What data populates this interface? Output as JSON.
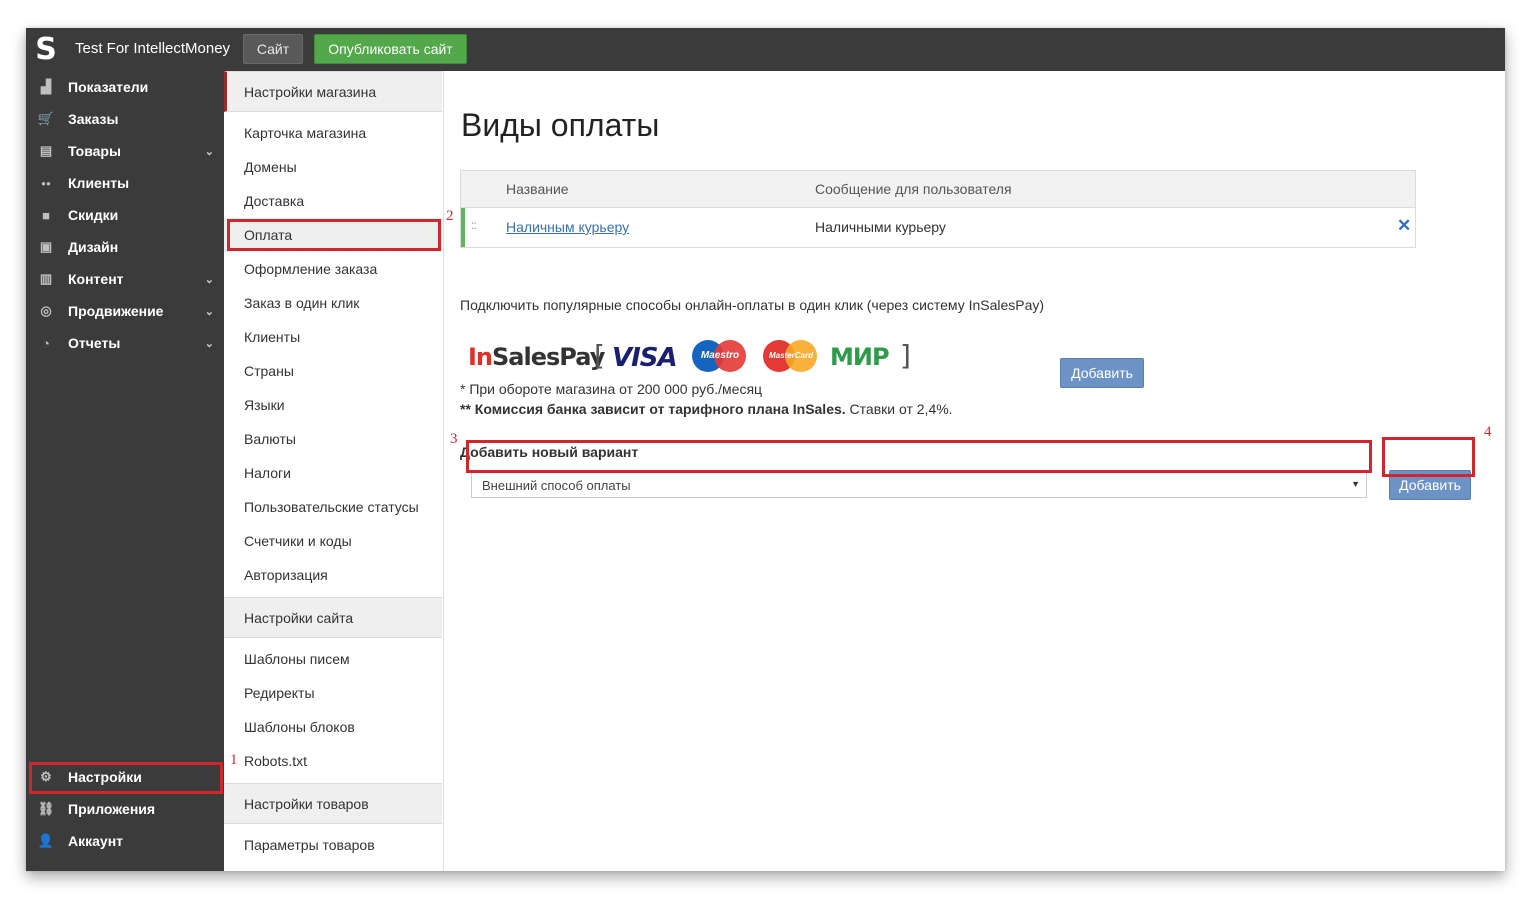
{
  "topbar": {
    "logo_glyph": "S",
    "shop_name": "Test For IntellectMoney",
    "site_button": "Сайт",
    "publish_button": "Опубликовать сайт"
  },
  "sidebar": {
    "items": [
      {
        "label": "Показатели",
        "icon": "chart-icon",
        "glyph": "▟"
      },
      {
        "label": "Заказы",
        "icon": "cart-icon",
        "glyph": "🛒"
      },
      {
        "label": "Товары",
        "icon": "book-icon",
        "glyph": "▤",
        "chevron": "⌄"
      },
      {
        "label": "Клиенты",
        "icon": "users-icon",
        "glyph": "●●"
      },
      {
        "label": "Скидки",
        "icon": "gift-icon",
        "glyph": "■"
      },
      {
        "label": "Дизайн",
        "icon": "image-icon",
        "glyph": "▣"
      },
      {
        "label": "Контент",
        "icon": "files-icon",
        "glyph": "▥",
        "chevron": "⌄"
      },
      {
        "label": "Продвижение",
        "icon": "target-icon",
        "glyph": "◎",
        "chevron": "⌄"
      },
      {
        "label": "Отчеты",
        "icon": "pie-icon",
        "glyph": "◔",
        "chevron": "⌄"
      }
    ],
    "bottom_items": [
      {
        "label": "Настройки",
        "icon": "gear-icon",
        "glyph": "⚙"
      },
      {
        "label": "Приложения",
        "icon": "link-icon",
        "glyph": "⛓"
      },
      {
        "label": "Аккаунт",
        "icon": "user-icon",
        "glyph": "👤"
      }
    ]
  },
  "settings_menu": {
    "shop_head": "Настройки магазина",
    "shop_items": [
      "Карточка магазина",
      "Домены",
      "Доставка",
      "Оплата",
      "Оформление заказа",
      "Заказ в один клик",
      "Клиенты",
      "Страны",
      "Языки",
      "Валюты",
      "Налоги",
      "Пользовательские статусы",
      "Счетчики и коды",
      "Авторизация"
    ],
    "site_head": "Настройки сайта",
    "site_items": [
      "Шаблоны писем",
      "Редиректы",
      "Шаблоны блоков",
      "Robots.txt"
    ],
    "goods_head": "Настройки товаров",
    "goods_items": [
      "Параметры товаров"
    ]
  },
  "main": {
    "title": "Виды оплаты",
    "table": {
      "col_name": "Название",
      "col_message": "Сообщение для пользователя",
      "rows": [
        {
          "name": "Наличным курьеру",
          "message": "Наличными курьеру",
          "delete": "✕",
          "drag": "::"
        }
      ]
    },
    "connect_text": "Подключить популярные способы онлайн-оплаты в один клик (через систему InSalesPay)",
    "logos": {
      "insales_in": "In",
      "insales_rest": "SalesPay",
      "bracket_open": "[",
      "visa": "VISA",
      "maestro": "Maestro",
      "mastercard": "MasterCard",
      "mir": "МИР",
      "bracket_close": "]"
    },
    "add_button_1": "Добавить",
    "note1": "* При обороте магазина от 200 000 руб./месяц",
    "note2_bold": "** Комиссия банка зависит от тарифного плана InSales.",
    "note2_rest": " Ставки от 2,4%.",
    "new_label": "Добавить новый вариант",
    "select_value": "Внешний способ оплаты",
    "select_arrow": "▼",
    "add_button_2": "Добавить"
  },
  "annotations": [
    "1",
    "2",
    "3",
    "4"
  ],
  "colors": {
    "highlight": "#d0262d",
    "accent_blue": "#6c92c6",
    "publish_green": "#52a84a",
    "sidebar": "#3b3b3b"
  }
}
